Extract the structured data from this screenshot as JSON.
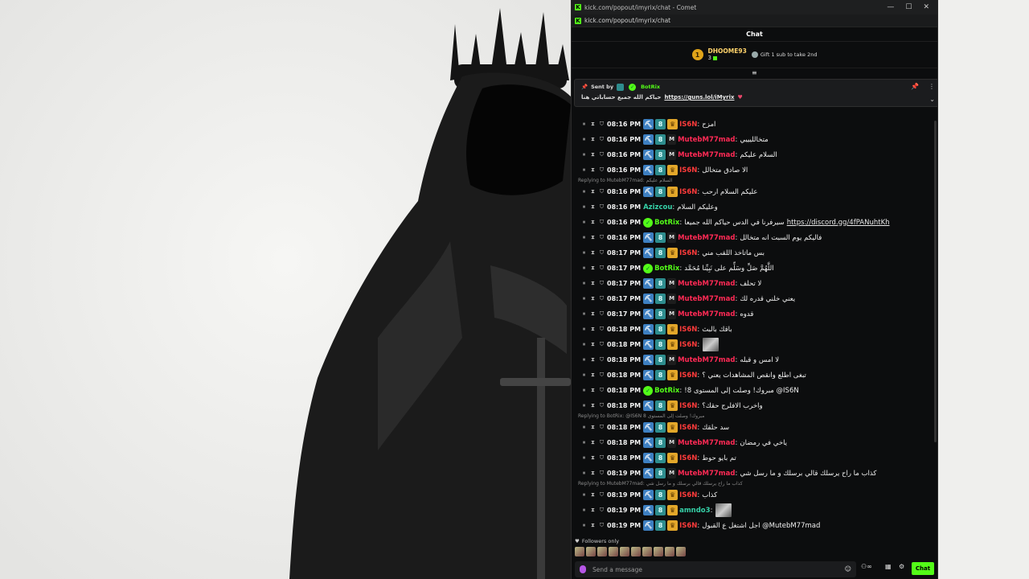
{
  "window": {
    "title": "kick.com/popout/imyrix/chat - Comet",
    "url": "kick.com/popout/imyrix/chat",
    "controls": {
      "minimize": "—",
      "maximize": "☐",
      "close": "✕"
    }
  },
  "chat": {
    "header": "Chat",
    "subgoal": {
      "rank": "1",
      "name": "DHOOME93",
      "count": "3",
      "gift_text": "Gift 1 sub to take 2nd"
    },
    "pinned": {
      "sent_by_label": "Sent by",
      "sender": "BotRix",
      "text": "حياكم الله جميع حساباتي هنا",
      "link": "https://guns.lol/iMyrix"
    },
    "messages": [
      {
        "time": "08:16 PM",
        "user": "IS6N",
        "color": "#ff3b3b",
        "badges": [
          "tool",
          "bot",
          "crown"
        ],
        "text": "امزح"
      },
      {
        "time": "08:16 PM",
        "user": "MutebM77mad",
        "color": "#ff2a55",
        "badges": [
          "tool",
          "bot",
          "mod"
        ],
        "text": "متخالليييي"
      },
      {
        "time": "08:16 PM",
        "user": "MutebM77mad",
        "color": "#ff2a55",
        "badges": [
          "tool",
          "bot",
          "mod"
        ],
        "text": "السلام عليكم"
      },
      {
        "time": "08:16 PM",
        "user": "IS6N",
        "color": "#ff3b3b",
        "badges": [
          "tool",
          "bot",
          "crown"
        ],
        "text": "الا صادق متخالل"
      },
      {
        "time": "08:16 PM",
        "user": "IS6N",
        "color": "#ff3b3b",
        "badges": [
          "tool",
          "bot",
          "crown"
        ],
        "text": "عليكم السلام ارحب",
        "reply": "Replying to MutebM77mad: السلام عليكم"
      },
      {
        "time": "08:16 PM",
        "user": "Azizcou",
        "color": "#35d0a7",
        "badges": [],
        "text": "وعليكم السلام"
      },
      {
        "time": "08:16 PM",
        "user": "BotRix",
        "color": "#53fc18",
        "badges": [
          "verified"
        ],
        "text": "سيرفرنا في الدس حياكم الله جميعا",
        "link": "https://discord.gg/4fPANuhtKh"
      },
      {
        "time": "08:16 PM",
        "user": "MutebM77mad",
        "color": "#ff2a55",
        "badges": [
          "tool",
          "bot",
          "mod"
        ],
        "text": "فاليكم يوم السبت انه متخالل"
      },
      {
        "time": "08:17 PM",
        "user": "IS6N",
        "color": "#ff3b3b",
        "badges": [
          "tool",
          "bot",
          "crown"
        ],
        "text": "بس ماتاخذ اللقب مني"
      },
      {
        "time": "08:17 PM",
        "user": "BotRix",
        "color": "#53fc18",
        "badges": [
          "verified"
        ],
        "text": "اللَّهُمَّ صَلِّ وسَلِّم على نَبِيِّنا مُحَمَّد"
      },
      {
        "time": "08:17 PM",
        "user": "MutebM77mad",
        "color": "#ff2a55",
        "badges": [
          "tool",
          "bot",
          "mod"
        ],
        "text": "لا تحلف"
      },
      {
        "time": "08:17 PM",
        "user": "MutebM77mad",
        "color": "#ff2a55",
        "badges": [
          "tool",
          "bot",
          "mod"
        ],
        "text": "يعني خلني قدره لك"
      },
      {
        "time": "08:17 PM",
        "user": "MutebM77mad",
        "color": "#ff2a55",
        "badges": [
          "tool",
          "bot",
          "mod"
        ],
        "text": "قدوه"
      },
      {
        "time": "08:18 PM",
        "user": "IS6N",
        "color": "#ff3b3b",
        "badges": [
          "tool",
          "bot",
          "crown"
        ],
        "text": "باقك بالبث"
      },
      {
        "time": "08:18 PM",
        "user": "IS6N",
        "color": "#ff3b3b",
        "badges": [
          "tool",
          "bot",
          "crown"
        ],
        "text": "",
        "image": true
      },
      {
        "time": "08:18 PM",
        "user": "MutebM77mad",
        "color": "#ff2a55",
        "badges": [
          "tool",
          "bot",
          "mod"
        ],
        "text": "لا امس و قبله"
      },
      {
        "time": "08:18 PM",
        "user": "IS6N",
        "color": "#ff3b3b",
        "badges": [
          "tool",
          "bot",
          "crown"
        ],
        "text": "تبغى اطلع وانقص المشاهدات يعني ؟"
      },
      {
        "time": "08:18 PM",
        "user": "BotRix",
        "color": "#53fc18",
        "badges": [
          "verified"
        ],
        "text": "!مبروك! وصلت إلى المستوى 8 @IS6N"
      },
      {
        "time": "08:18 PM",
        "user": "IS6N",
        "color": "#ff3b3b",
        "badges": [
          "tool",
          "bot",
          "crown"
        ],
        "text": "واخرب الافلرج حقك؟"
      },
      {
        "time": "08:18 PM",
        "user": "IS6N",
        "color": "#ff3b3b",
        "badges": [
          "tool",
          "bot",
          "crown"
        ],
        "text": "سد حلقك",
        "reply": "Replying to BotRix: @IS6N مبروك! وصلت إلى المستوى 8"
      },
      {
        "time": "08:18 PM",
        "user": "MutebM77mad",
        "color": "#ff2a55",
        "badges": [
          "tool",
          "bot",
          "mod"
        ],
        "text": "ياخي في رمضان"
      },
      {
        "time": "08:18 PM",
        "user": "IS6N",
        "color": "#ff3b3b",
        "badges": [
          "tool",
          "bot",
          "crown"
        ],
        "text": "تم بايو حوط"
      },
      {
        "time": "08:19 PM",
        "user": "MutebM77mad",
        "color": "#ff2a55",
        "badges": [
          "tool",
          "bot",
          "mod"
        ],
        "text": "كذاب ما راح يرسلك قالي برسلك و ما رسل شي"
      },
      {
        "time": "08:19 PM",
        "user": "IS6N",
        "color": "#ff3b3b",
        "badges": [
          "tool",
          "bot",
          "crown"
        ],
        "text": "كذاب",
        "reply": "Replying to MutebM77mad: كذاب ما راح يرسلك قالي برسلك و ما رسل شي"
      },
      {
        "time": "08:19 PM",
        "user": "amndo3",
        "color": "#35d0a7",
        "badges": [
          "tool",
          "bot",
          "crown"
        ],
        "text": "",
        "image": true
      },
      {
        "time": "08:19 PM",
        "user": "IS6N",
        "color": "#ff3b3b",
        "badges": [
          "tool",
          "bot",
          "crown"
        ],
        "text": "اجل اشتغل ع القبول @MutebM77mad"
      }
    ],
    "followers_only": "Followers only",
    "composer": {
      "placeholder": "Send a message",
      "send_label": "Chat"
    }
  }
}
